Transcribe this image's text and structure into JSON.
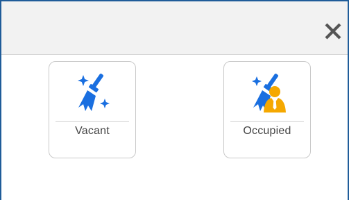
{
  "dialog": {
    "close_icon": "close-icon",
    "colors": {
      "frame_border": "#1f5c99",
      "header_bg": "#f2f2f2",
      "icon_blue": "#1a6fe0",
      "person_orange": "#f5a800"
    }
  },
  "options": [
    {
      "label": "Vacant",
      "icon": "broom-sparkle-icon"
    },
    {
      "label": "Occupied",
      "icon": "broom-person-icon"
    }
  ]
}
